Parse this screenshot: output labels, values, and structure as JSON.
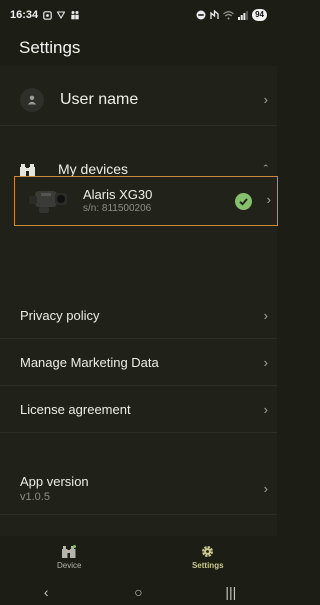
{
  "status_bar": {
    "time": "16:34",
    "battery": "94",
    "icons": [
      "screenshot-icon",
      "vpn-icon",
      "people-icon",
      "dnd-icon",
      "nfc-icon",
      "wifi-icon",
      "signal-icon"
    ]
  },
  "header": {
    "title": "Settings"
  },
  "user": {
    "label": "User name"
  },
  "devices": {
    "label": "My devices",
    "items": [
      {
        "name": "Alaris XG30",
        "serial": "s/n: 811500206",
        "status": "connected"
      }
    ]
  },
  "links": {
    "privacy": "Privacy policy",
    "marketing": "Manage Marketing Data",
    "license": "License agreement"
  },
  "app_version": {
    "label": "App version",
    "value": "v1.0.5"
  },
  "tabs": [
    {
      "label": "Device",
      "active": false
    },
    {
      "label": "Settings",
      "active": true
    }
  ],
  "colors": {
    "accent_border": "#c98a3a",
    "check_green": "#86c06c",
    "active_tab": "#c9c98f",
    "background": "#1c1d15"
  }
}
